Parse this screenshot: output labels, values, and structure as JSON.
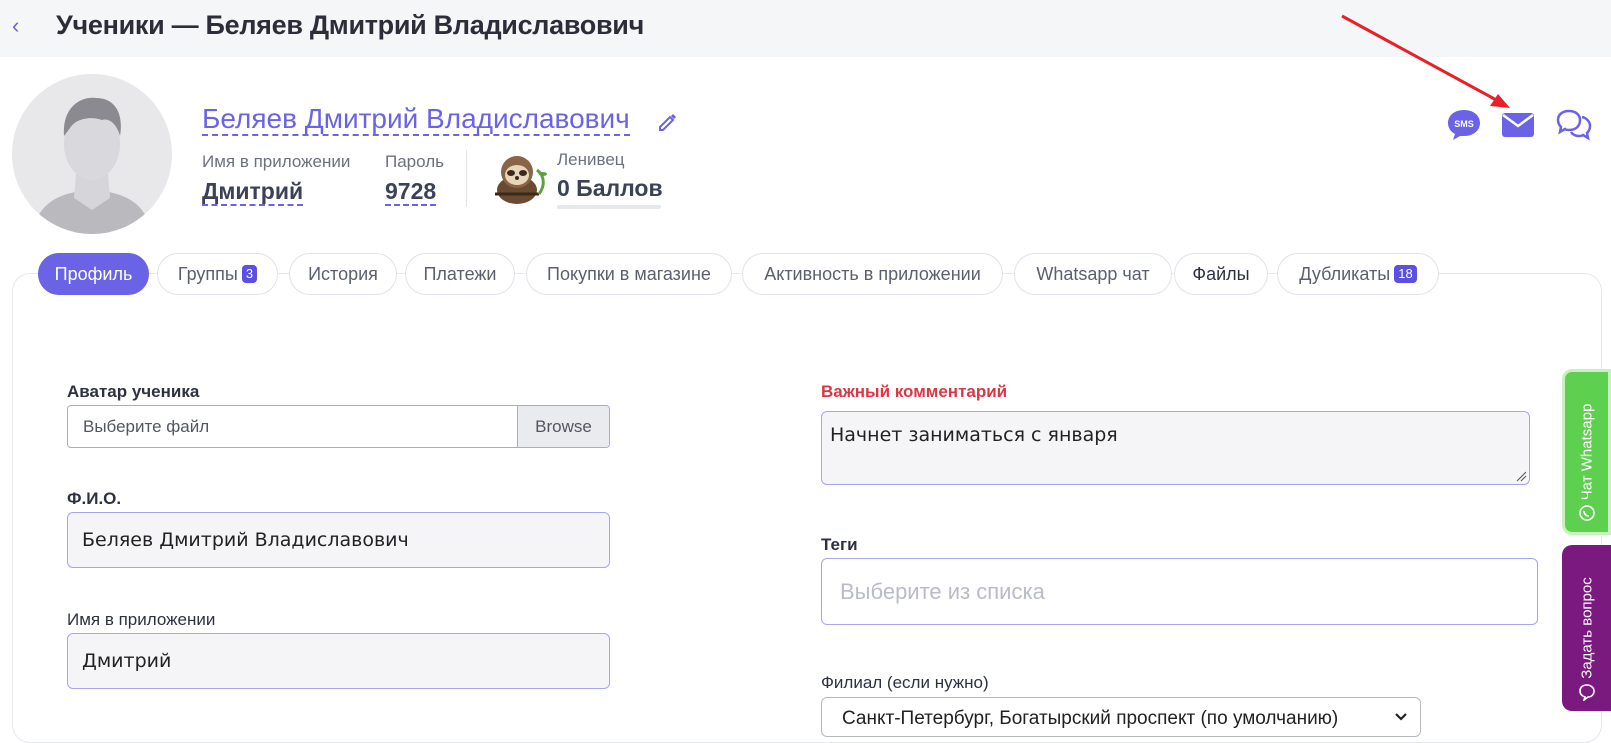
{
  "header": {
    "back_icon": "chevron-left-icon",
    "title": "Ученики — Беляев Дмитрий Владиславович"
  },
  "profile": {
    "full_name": "Беляев Дмитрий Владиславович",
    "app_name_label": "Имя в приложении",
    "app_name_value": "Дмитрий",
    "password_label": "Пароль",
    "password_value": "9728",
    "level_label": "Ленивец",
    "points_value": "0 Баллов"
  },
  "actions": {
    "sms_icon": "sms-icon",
    "sms_text": "SMS",
    "email_icon": "envelope-icon",
    "chat_icon": "chat-bubbles-icon"
  },
  "tabs": [
    {
      "label": "Профиль",
      "active": true
    },
    {
      "label": "Группы",
      "badge": "3"
    },
    {
      "label": "История"
    },
    {
      "label": "Платежи"
    },
    {
      "label": "Покупки в магазине"
    },
    {
      "label": "Активность в приложении"
    },
    {
      "label": "Whatsapp чат"
    },
    {
      "label": "Файлы"
    },
    {
      "label": "Дубликаты",
      "badge": "18"
    }
  ],
  "form": {
    "avatar_label": "Аватар ученика",
    "avatar_placeholder": "Выберите файл",
    "browse_label": "Browse",
    "fio_label": "Ф.И.О.",
    "fio_value": "Беляев Дмитрий Владиславович",
    "app_name_label": "Имя в приложении",
    "app_name_value": "Дмитрий",
    "comment_label": "Важный комментарий",
    "comment_value": "Начнет заниматься с января",
    "tags_label": "Теги",
    "tags_placeholder": "Выберите из списка",
    "branch_label": "Филиал (если нужно)",
    "branch_value": "Санкт-Петербург, Богатырский проспект (по умолчанию)"
  },
  "side": {
    "whatsapp_label": "Чат Whatsapp",
    "question_label": "Задать вопрос"
  },
  "colors": {
    "accent": "#6b63e6",
    "important": "#dc3545",
    "whatsapp": "#5ed04f",
    "question": "#7a1a7f",
    "annotation_arrow": "#e8202a"
  }
}
